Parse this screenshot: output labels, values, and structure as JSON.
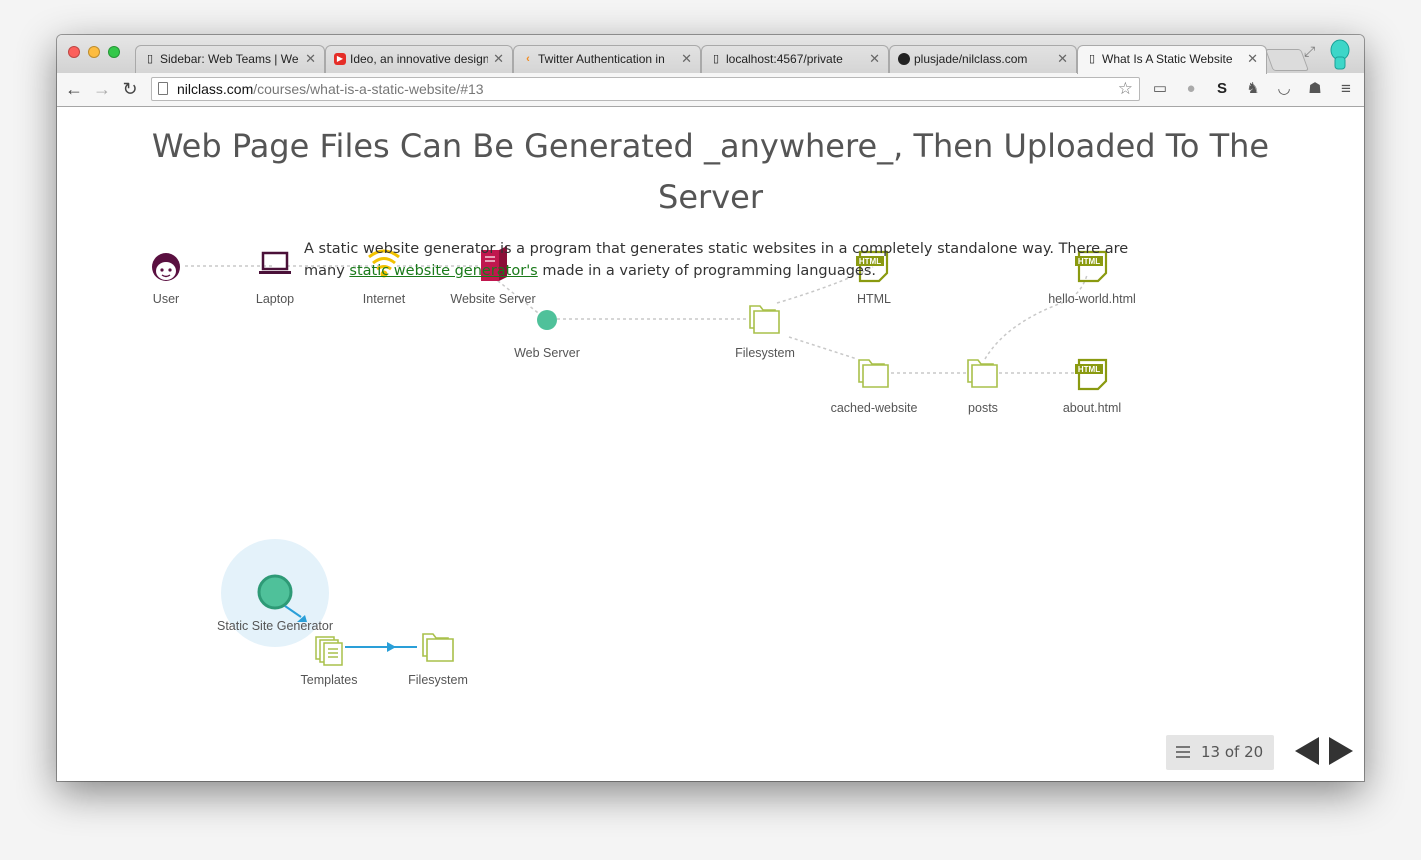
{
  "browser": {
    "tabs": [
      {
        "title": "Sidebar: Web Teams | We",
        "icon": "page-icon"
      },
      {
        "title": "Ideo, an innovative design",
        "icon": "youtube-icon"
      },
      {
        "title": "Twitter Authentication in",
        "icon": "sitepoint-icon"
      },
      {
        "title": "localhost:4567/private",
        "icon": "page-icon"
      },
      {
        "title": "plusjade/nilclass.com",
        "icon": "github-icon"
      },
      {
        "title": "What Is A Static Website",
        "icon": "page-icon",
        "active": true
      }
    ],
    "url_host": "nilclass.com",
    "url_path": "/courses/what-is-a-static-website/#13"
  },
  "slide": {
    "title": "Web Page Files Can Be Generated _anywhere_, Then Uploaded To The Server",
    "paragraph_before": "A static website generator is a program that generates static websites in a completely standalone way. There are many ",
    "link_text": "static website generator's",
    "paragraph_after": " made in a variety of programming languages."
  },
  "diagram": {
    "top_nodes": {
      "user": "User",
      "laptop": "Laptop",
      "internet": "Internet",
      "website_server": "Website Server",
      "web_server": "Web Server",
      "filesystem": "Filesystem",
      "html": "HTML",
      "cached_website": "cached-website",
      "posts": "posts",
      "hello_world": "hello-world.html",
      "about": "about.html"
    },
    "bottom_nodes": {
      "static_site_generator": "Static Site Generator",
      "templates": "Templates",
      "filesystem": "Filesystem"
    },
    "html_badge": "HTML",
    "colors": {
      "user": "#5a1040",
      "laptop": "#4a1038",
      "internet": "#f2c200",
      "server": "#c0174e",
      "web_server": "#4fc19a",
      "folder": "#a9c04a",
      "html_file": "#8a9a10",
      "flow": "#2a9fd8",
      "highlight": "#e4f2fa"
    }
  },
  "pager": {
    "count": "13 of 20"
  }
}
